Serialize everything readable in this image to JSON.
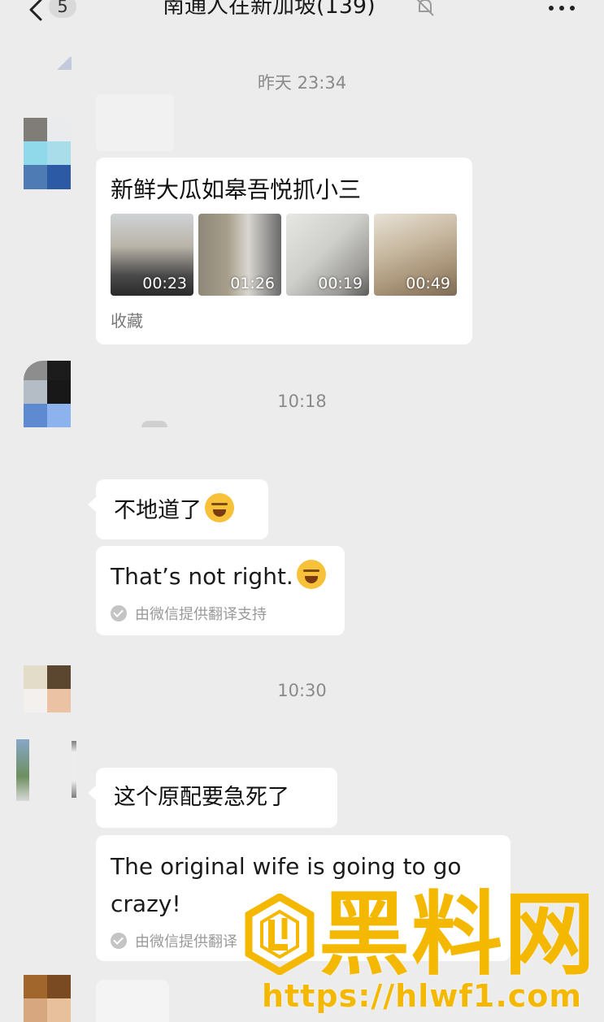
{
  "header": {
    "unread_count": "5",
    "title": "南通人在新加坡(139)"
  },
  "timestamps": [
    "昨天 23:34",
    "10:18",
    "10:30"
  ],
  "messages": {
    "favorites_card": {
      "title": "新鲜大瓜如皋吾悦抓小三",
      "videos": [
        {
          "duration": "00:23"
        },
        {
          "duration": "01:26"
        },
        {
          "duration": "00:19"
        },
        {
          "duration": "00:49"
        }
      ],
      "footer": "收藏"
    },
    "msg1": {
      "text": "不地道了",
      "translation": "That’s not right.",
      "translation_note": "由微信提供翻译支持"
    },
    "msg2": {
      "text": "这个原配要急死了",
      "translation_line1": "The original wife is going to go",
      "translation_line2": "crazy!",
      "translation_note": "由微信提供翻译"
    }
  },
  "watermark": {
    "brand": "黑料网",
    "url": "https://hlwf1.com"
  },
  "colors": {
    "background": "#ececec",
    "bubble": "#ffffff",
    "watermark": "#f5b800"
  }
}
